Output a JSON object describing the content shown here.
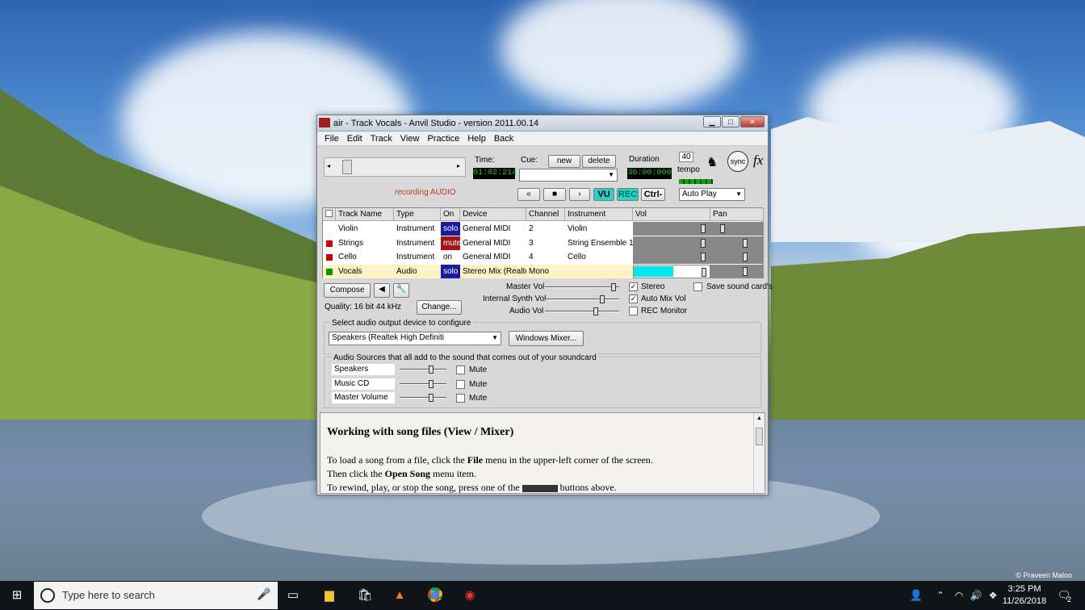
{
  "window": {
    "title": "air - Track Vocals - Anvil Studio - version 2011.00.14",
    "menu": [
      "File",
      "Edit",
      "Track",
      "View",
      "Practice",
      "Help",
      "Back"
    ]
  },
  "transport": {
    "time_label": "Time:",
    "time_value": "01:02:214",
    "cue_label": "Cue:",
    "new_label": "new",
    "delete_label": "delete",
    "duration_label": "Duration",
    "duration_value": "36:00:000",
    "tempo_value": "40",
    "tempo_label": "tempo",
    "sync_label": "sync",
    "fx_label": "fx",
    "status_text": "recording AUDIO",
    "vu_label": "VU",
    "rec_label": "REC",
    "ctrl_label": "Ctrl-",
    "autoplay_value": "Auto Play"
  },
  "tracks": {
    "headers": [
      "Track Name",
      "Type",
      "On",
      "Device",
      "Channel",
      "Instrument",
      "Vol",
      "Pan"
    ],
    "rows": [
      {
        "name": "Violin",
        "type": "Instrument",
        "on": "solo",
        "device": "General MIDI",
        "channel": "2",
        "instrument": "Violin",
        "color": "#ffffff"
      },
      {
        "name": "Strings",
        "type": "Instrument",
        "on": "mute",
        "device": "General MIDI",
        "channel": "3",
        "instrument": "String Ensemble 1",
        "color": "#cc0000"
      },
      {
        "name": "Cello",
        "type": "Instrument",
        "on": "on",
        "device": "General MIDI",
        "channel": "4",
        "instrument": "Cello",
        "color": "#cc0000"
      },
      {
        "name": "Vocals",
        "type": "Audio",
        "on": "solo",
        "device": "Stereo Mix (Realte",
        "channel": "Mono",
        "instrument": "",
        "color": "#009900"
      }
    ],
    "vocals_level": 0.65
  },
  "mixer": {
    "compose_label": "Compose",
    "quality_text": "Quality: 16 bit 44 kHz",
    "change_label": "Change...",
    "master_vol_label": "Master Vol",
    "internal_synth_label": "Internal Synth Vol",
    "audio_vol_label": "Audio Vol",
    "stereo_label": "Stereo",
    "auto_mix_label": "Auto Mix Vol",
    "rec_monitor_label": "REC Monitor",
    "save_sound_label": "Save sound card's",
    "output_device_label": "Select audio output device to configure",
    "output_device_value": "Speakers (Realtek High Definiti",
    "windows_mixer_label": "Windows Mixer...",
    "sources_label": "Audio Sources that all add to the sound that comes out of your soundcard",
    "sources": [
      {
        "name": "Speakers",
        "mute": "Mute"
      },
      {
        "name": "Music CD",
        "mute": "Mute"
      },
      {
        "name": "Master Volume",
        "mute": "Mute"
      }
    ]
  },
  "help": {
    "heading": "Working with song files (View / Mixer)",
    "line1_pre": "To load a song from a file, click the ",
    "line1_bold": "File",
    "line1_post": " menu in the upper-left corner of the screen.",
    "line2_pre": "Then click the ",
    "line2_bold": "Open Song",
    "line2_post": " menu item.",
    "line3_pre": "To rewind, play, or stop the song, press one of the ",
    "line3_post": " buttons above."
  },
  "desktop": {
    "credit": "© Praveen Maloo"
  },
  "taskbar": {
    "search_placeholder": "Type here to search",
    "time": "3:25 PM",
    "date": "11/26/2018",
    "notification_count": "2"
  }
}
